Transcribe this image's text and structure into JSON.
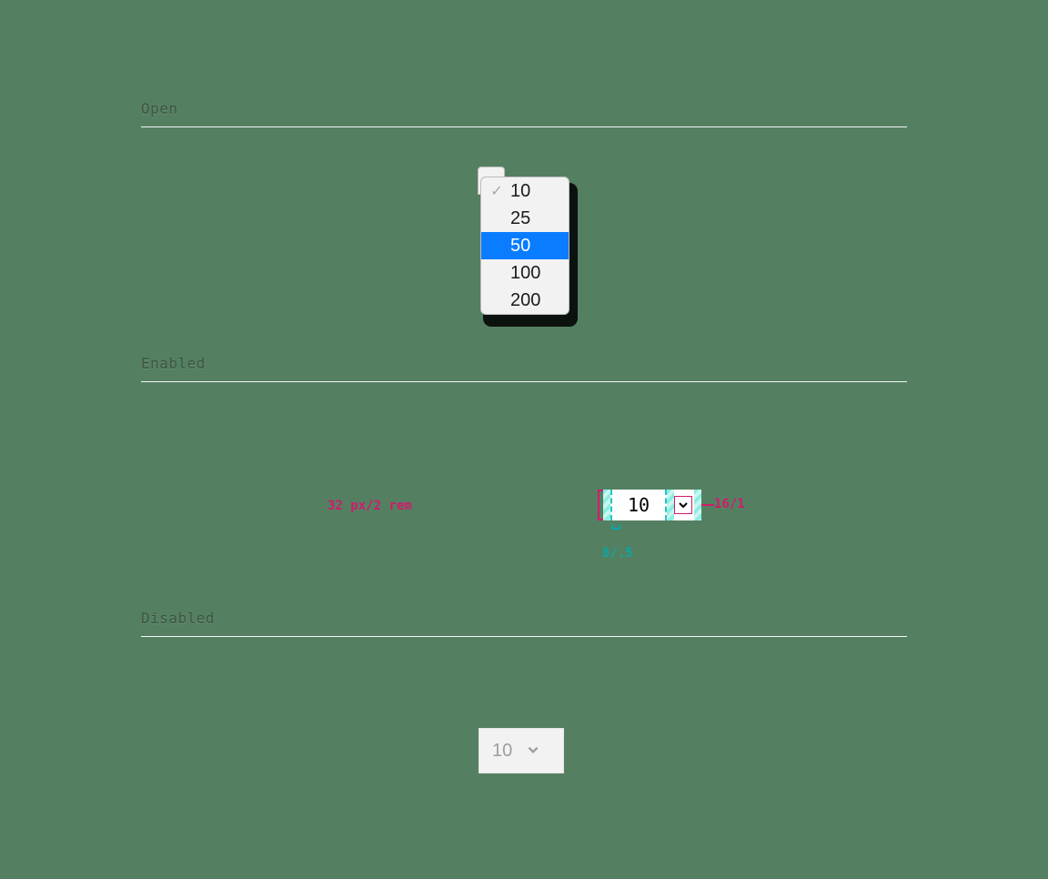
{
  "sections": {
    "open": {
      "title": "Open"
    },
    "enabled": {
      "title": "Enabled"
    },
    "disabled": {
      "title": "Disabled"
    }
  },
  "dropdown": {
    "options": [
      {
        "value": "10",
        "checked": true,
        "highlighted": false
      },
      {
        "value": "25",
        "checked": false,
        "highlighted": false
      },
      {
        "value": "50",
        "checked": false,
        "highlighted": true
      },
      {
        "value": "100",
        "checked": false,
        "highlighted": false
      },
      {
        "value": "200",
        "checked": false,
        "highlighted": false
      }
    ]
  },
  "spec": {
    "height_label": "32 px/2 rem",
    "chevron_label": "16/1",
    "padding_label": "8/.5",
    "value": "10"
  },
  "disabled_select": {
    "value": "10"
  },
  "colors": {
    "accent_blue": "#0a7cff",
    "dim_pink": "#d31a6d",
    "dim_teal": "#0aa6a6",
    "bg": "#548061"
  }
}
